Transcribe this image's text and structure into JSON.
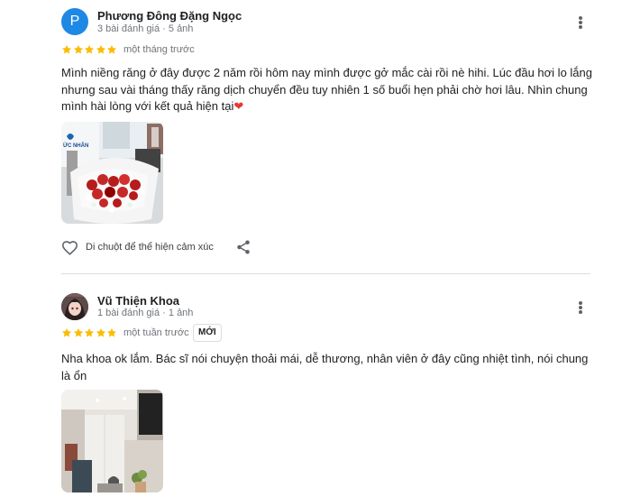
{
  "reviews": [
    {
      "avatar_letter": "P",
      "avatar_color": "#1e88e5",
      "author": "Phương Đông Đặng Ngọc",
      "meta": "3 bài đánh giá · 5 ảnh",
      "rating": 5,
      "time": "một tháng trước",
      "text": "Mình niềng răng ở đây được 2 năm rồi hôm nay mình được gở mắc cài rồi nè hihi. Lúc đầu hơi lo lắng nhưng sau vài tháng thấy răng dịch chuyển đều tuy nhiên 1 số buổi hẹn phải chờ hơi lâu. Nhìn chung mình hài lòng với kết quả hiện tại",
      "emoji": "❤",
      "photo_sign_text": "ỨC NHÂN",
      "react_label": "Di chuột để thể hiện cảm xúc",
      "like_icon": "heart-outline-icon",
      "share_icon": "share-icon"
    },
    {
      "author": "Vũ Thiện Khoa",
      "meta": "1 bài đánh giá · 1 ảnh",
      "rating": 5,
      "time": "một tuần trước",
      "badge": "MỚI",
      "text": "Nha khoa ok lắm. Bác sĩ nói chuyện thoải mái, dễ thương, nhân viên ở đây cũng nhiệt tình, nói chung là ổn"
    }
  ],
  "colors": {
    "star": "#fbbc04",
    "divider": "#dadce0",
    "secondary_text": "#70757a"
  }
}
